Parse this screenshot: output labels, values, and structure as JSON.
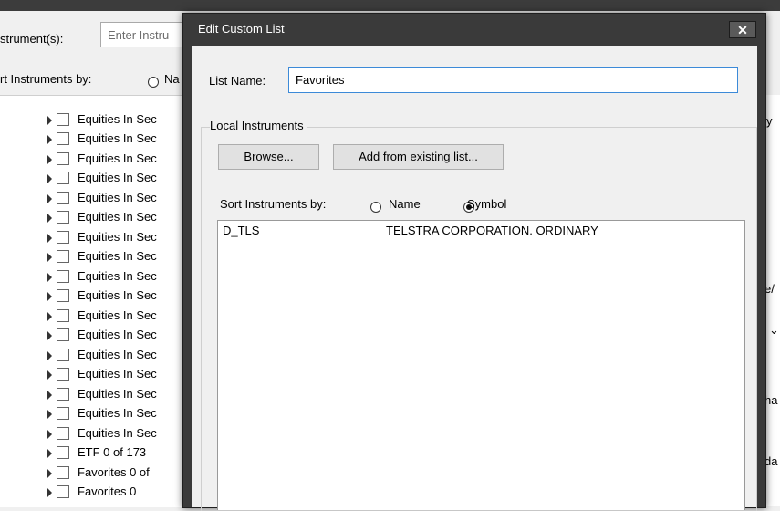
{
  "background": {
    "instruments_label": "strument(s):",
    "instruments_placeholder": "Enter Instru",
    "sort_label": "rt Instruments by:",
    "sort_name_fragment": "Na",
    "tree_items": [
      "Equities In Sec",
      "Equities In Sec",
      "Equities In Sec",
      "Equities In Sec",
      "Equities In Sec",
      "Equities In Sec",
      "Equities In Sec",
      "Equities In Sec",
      "Equities In Sec",
      "Equities In Sec",
      "Equities In Sec",
      "Equities In Sec",
      "Equities In Sec",
      "Equities In Sec",
      "Equities In Sec",
      "Equities In Sec",
      "Equities In Sec",
      "ETF  0 of 173",
      "Favorites  0 of",
      "Favorites  0"
    ],
    "right_fragments": [
      "y",
      "e/",
      "⌄",
      "ha",
      "da"
    ]
  },
  "dialog": {
    "title": "Edit Custom List",
    "close_glyph": "✕",
    "list_name_label": "List Name:",
    "list_name_value": "Favorites",
    "group_label": "Local Instruments",
    "browse_button": "Browse...",
    "add_from_button": "Add from existing list...",
    "sort_label": "Sort Instruments by:",
    "sort_options": [
      {
        "label": "Name",
        "selected": false
      },
      {
        "label": "Symbol",
        "selected": true
      }
    ],
    "instruments": [
      {
        "symbol": "D_TLS",
        "name": "TELSTRA CORPORATION. ORDINARY"
      }
    ]
  },
  "colors": {
    "title_bar": "#3a3a3a",
    "input_focus_border": "#3c8ad8"
  }
}
